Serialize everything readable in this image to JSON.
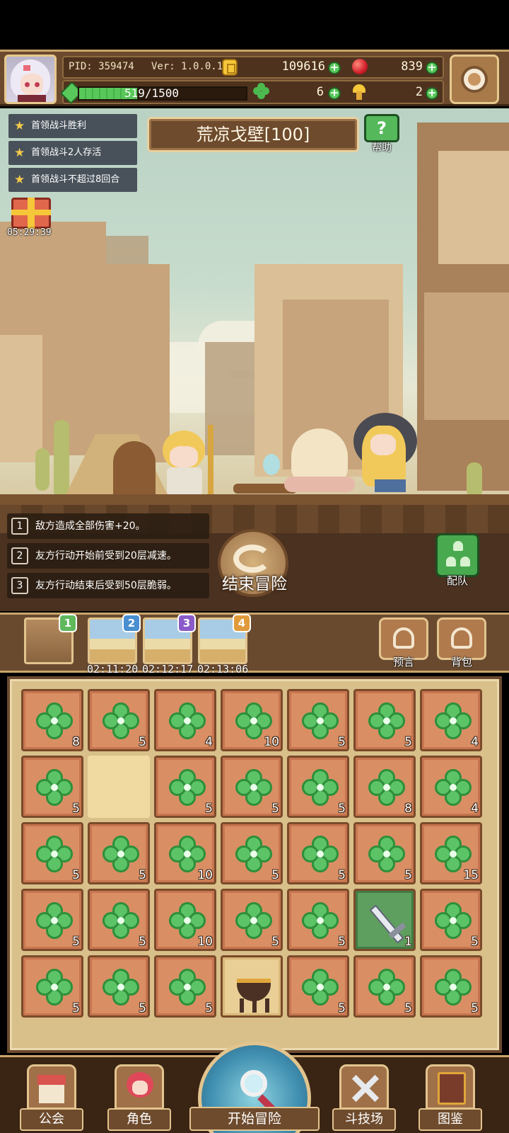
{
  "hud": {
    "pid": "PID: 359474",
    "version": "Ver: 1.0.0.10",
    "gold": "109616",
    "gems": "839",
    "energy": "519/1500",
    "energy_fraction": 0.346,
    "clovers": "6",
    "mushrooms": "2"
  },
  "scene": {
    "stage_title": "荒凉戈壁[100]",
    "help_label": "帮助",
    "quests": [
      "首领战斗胜利",
      "首领战斗2人存活",
      "首领战斗不超过8回合"
    ],
    "gift_timer": "05:29:39"
  },
  "battle": {
    "effects": [
      {
        "num": "1",
        "text": "敌方造成全部伤害+20。"
      },
      {
        "num": "2",
        "text": "友方行动开始前受到20层减速。"
      },
      {
        "num": "3",
        "text": "友方行动结束后受到50层脆弱。"
      }
    ],
    "end_label": "结束冒险",
    "team_label": "配队"
  },
  "stages": {
    "items": [
      {
        "badge": "1",
        "timer": "",
        "badge_color": "#5fb85c"
      },
      {
        "badge": "2",
        "timer": "02:11:20",
        "badge_color": "#4a8fd0"
      },
      {
        "badge": "3",
        "timer": "02:12:17",
        "badge_color": "#8a5ac8"
      },
      {
        "badge": "4",
        "timer": "02:13:06",
        "badge_color": "#e09a3a"
      }
    ],
    "forecast_label": "预言",
    "bag_label": "背包"
  },
  "inventory": {
    "rows": [
      [
        {
          "t": "clover",
          "q": "8"
        },
        {
          "t": "clover",
          "q": "5"
        },
        {
          "t": "clover",
          "q": "4"
        },
        {
          "t": "clover",
          "q": "10"
        },
        {
          "t": "clover",
          "q": "5"
        },
        {
          "t": "clover",
          "q": "5"
        },
        {
          "t": "clover",
          "q": "4"
        }
      ],
      [
        {
          "t": "clover",
          "q": "5"
        },
        {
          "t": "empty",
          "q": ""
        },
        {
          "t": "clover",
          "q": "5"
        },
        {
          "t": "clover",
          "q": "5"
        },
        {
          "t": "clover",
          "q": "5"
        },
        {
          "t": "clover",
          "q": "8"
        },
        {
          "t": "clover",
          "q": "4"
        }
      ],
      [
        {
          "t": "clover",
          "q": "5"
        },
        {
          "t": "clover",
          "q": "5"
        },
        {
          "t": "clover",
          "q": "10"
        },
        {
          "t": "clover",
          "q": "5"
        },
        {
          "t": "clover",
          "q": "5"
        },
        {
          "t": "clover",
          "q": "5"
        },
        {
          "t": "clover",
          "q": "15"
        }
      ],
      [
        {
          "t": "clover",
          "q": "5"
        },
        {
          "t": "clover",
          "q": "5"
        },
        {
          "t": "clover",
          "q": "10"
        },
        {
          "t": "clover",
          "q": "5"
        },
        {
          "t": "clover",
          "q": "5"
        },
        {
          "t": "weapon",
          "q": "1"
        },
        {
          "t": "clover",
          "q": "5"
        }
      ],
      [
        {
          "t": "clover",
          "q": "5"
        },
        {
          "t": "clover",
          "q": "5"
        },
        {
          "t": "clover",
          "q": "5"
        },
        {
          "t": "cauldron",
          "q": ""
        },
        {
          "t": "clover",
          "q": "5"
        },
        {
          "t": "clover",
          "q": "5"
        },
        {
          "t": "clover",
          "q": "5"
        }
      ]
    ]
  },
  "nav": {
    "guild": "公会",
    "character": "角色",
    "start": "开始冒险",
    "arena": "斗技场",
    "codex": "图鉴"
  }
}
